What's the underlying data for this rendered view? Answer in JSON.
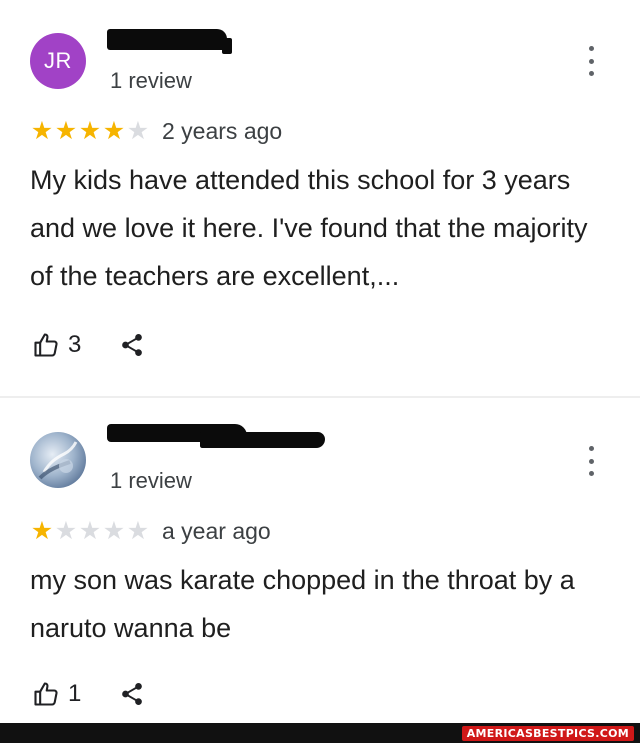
{
  "reviews": [
    {
      "avatar": {
        "type": "initials",
        "initials": "JR",
        "color": "#a142c6"
      },
      "review_count": "1 review",
      "rating": 4,
      "max_rating": 5,
      "date": "2 years ago",
      "text": "My kids have attended this school for 3 years and we love it here.  I've found that the majority of the teachers are excellent,...",
      "likes": "3",
      "icons": {
        "like": "thumbs-up-icon",
        "share": "share-icon",
        "more": "more-vert-icon"
      }
    },
    {
      "avatar": {
        "type": "photo",
        "color": "#7f97b5"
      },
      "review_count": "1 review",
      "rating": 1,
      "max_rating": 5,
      "date": "a year ago",
      "text": "my son was karate chopped in the throat by a naruto wanna be",
      "likes": "1",
      "icons": {
        "like": "thumbs-up-icon",
        "share": "share-icon",
        "more": "more-vert-icon"
      }
    }
  ],
  "colors": {
    "star_filled": "#f6b400",
    "star_empty": "#dadce0",
    "text": "#1f1f1f",
    "secondary_text": "#3c4043"
  },
  "watermark": "AMERICASBESTPICS.COM"
}
